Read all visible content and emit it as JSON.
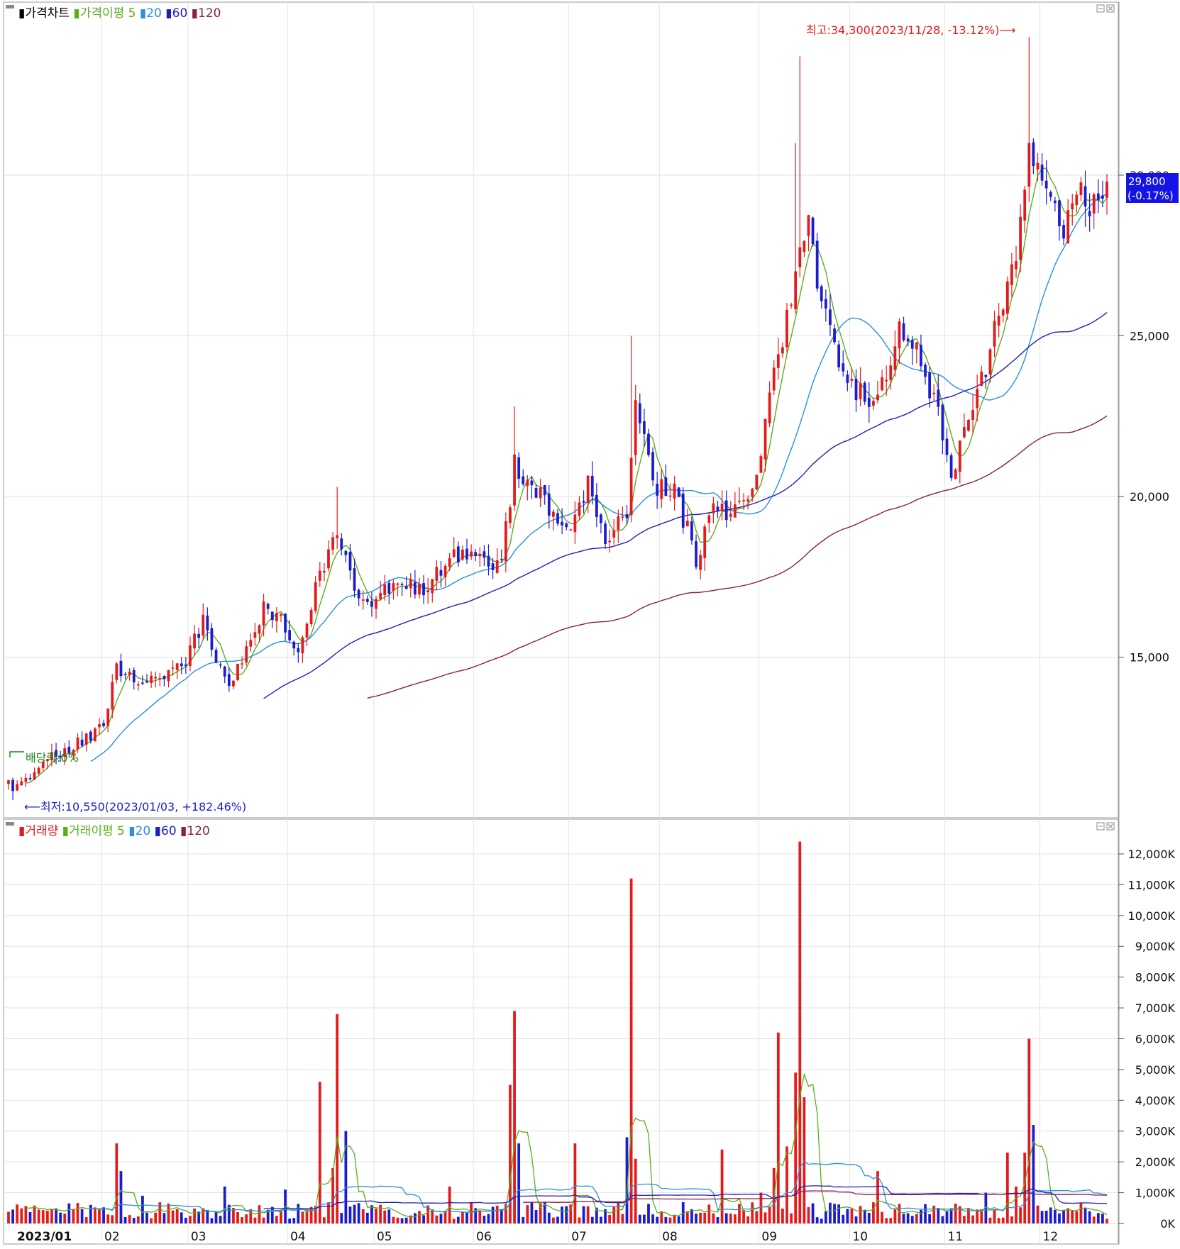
{
  "colors": {
    "up": "#e31b1b",
    "down": "#1c1ccf",
    "ma5": "#5aae1e",
    "ma20": "#2a8fe0",
    "ma60": "#1f1fbf",
    "ma120": "#8b1f4a",
    "grid": "#e2e2e2",
    "frame": "#9a9a9a",
    "current_bg": "#1414e6"
  },
  "price_panel": {
    "legend": [
      {
        "label": "가격차트",
        "color": "#000000"
      },
      {
        "label": "가격이평 5",
        "color": "#5aae1e"
      },
      {
        "label": "20",
        "color": "#2a8fe0"
      },
      {
        "label": "60",
        "color": "#1f1fbf"
      },
      {
        "label": "120",
        "color": "#8b1f4a"
      }
    ],
    "high_annotation": "최고:34,300(2023/11/28, -13.12%)⟶",
    "low_annotation": "⟵최저:10,550(2023/01/03, +182.46%)",
    "dividend_annotation": "배당락:0%",
    "current_price": "29,800",
    "current_change": "(-0.17%)"
  },
  "volume_panel": {
    "legend": [
      {
        "label": "거래량",
        "color": "#e31b1b"
      },
      {
        "label": "거래이평 5",
        "color": "#5aae1e"
      },
      {
        "label": "20",
        "color": "#2a8fe0"
      },
      {
        "label": "60",
        "color": "#1f1fbf"
      },
      {
        "label": "120",
        "color": "#8b1f4a"
      }
    ]
  },
  "chart_data": [
    {
      "type": "candlestick",
      "title": "",
      "ylim": [
        10000,
        35500
      ],
      "y_ticks": [
        {
          "value": 15000,
          "label": "15,000"
        },
        {
          "value": 20000,
          "label": "20,000"
        },
        {
          "value": 25000,
          "label": "25,000"
        },
        {
          "value": 30000,
          "label": "30,000"
        }
      ],
      "x_ticks": [
        "2023/01",
        "02",
        "03",
        "04",
        "05",
        "06",
        "07",
        "08",
        "09",
        "10",
        "11",
        "12"
      ],
      "price_keypoints": [
        [
          "2023/01/02",
          11200
        ],
        [
          "2023/01/03",
          10800
        ],
        [
          "2023/01/10",
          11500
        ],
        [
          "2023/01/20",
          12200
        ],
        [
          "2023/02/01",
          12800
        ],
        [
          "2023/02/06",
          14600
        ],
        [
          "2023/02/15",
          14300
        ],
        [
          "2023/02/28",
          14800
        ],
        [
          "2023/03/06",
          16200
        ],
        [
          "2023/03/14",
          13900
        ],
        [
          "2023/03/24",
          16500
        ],
        [
          "2023/03/31",
          16000
        ],
        [
          "2023/04/05",
          15200
        ],
        [
          "2023/04/12",
          17500
        ],
        [
          "2023/04/18",
          19000
        ],
        [
          "2023/04/25",
          16600
        ],
        [
          "2023/05/04",
          17200
        ],
        [
          "2023/05/16",
          17100
        ],
        [
          "2023/05/24",
          18200
        ],
        [
          "2023/06/01",
          18000
        ],
        [
          "2023/06/09",
          17900
        ],
        [
          "2023/06/14",
          21000
        ],
        [
          "2023/06/22",
          20000
        ],
        [
          "2023/06/30",
          19000
        ],
        [
          "2023/07/07",
          20300
        ],
        [
          "2023/07/13",
          18800
        ],
        [
          "2023/07/20",
          19500
        ],
        [
          "2023/07/24",
          23000
        ],
        [
          "2023/07/28",
          20400
        ],
        [
          "2023/08/04",
          20200
        ],
        [
          "2023/08/11",
          18100
        ],
        [
          "2023/08/17",
          19700
        ],
        [
          "2023/08/24",
          19500
        ],
        [
          "2023/08/31",
          20700
        ],
        [
          "2023/09/07",
          24600
        ],
        [
          "2023/09/12",
          25800
        ],
        [
          "2023/09/14",
          27600
        ],
        [
          "2023/09/18",
          29000
        ],
        [
          "2023/09/20",
          26800
        ],
        [
          "2023/09/27",
          24000
        ],
        [
          "2023/10/06",
          22800
        ],
        [
          "2023/10/13",
          23700
        ],
        [
          "2023/10/17",
          25200
        ],
        [
          "2023/10/24",
          24400
        ],
        [
          "2023/10/31",
          22000
        ],
        [
          "2023/11/02",
          20500
        ],
        [
          "2023/11/08",
          22300
        ],
        [
          "2023/11/13",
          23500
        ],
        [
          "2023/11/17",
          25600
        ],
        [
          "2023/11/23",
          27800
        ],
        [
          "2023/11/28",
          31200
        ],
        [
          "2023/12/04",
          29700
        ],
        [
          "2023/12/08",
          28200
        ],
        [
          "2023/12/13",
          29500
        ],
        [
          "2023/12/18",
          29200
        ],
        [
          "2023/12/22",
          29900
        ]
      ],
      "high": {
        "value": 34300,
        "date": "2023/11/28"
      },
      "low": {
        "value": 10550,
        "date": "2023/01/03"
      },
      "last": {
        "value": 29800,
        "change_pct": -0.17
      },
      "moving_averages": [
        5,
        20,
        60,
        120
      ]
    },
    {
      "type": "bar",
      "title": "",
      "ylabel": "",
      "ylim": [
        0,
        12500
      ],
      "unit": "K",
      "y_ticks": [
        {
          "value": 0,
          "label": "0K"
        },
        {
          "value": 1000,
          "label": "1,000K"
        },
        {
          "value": 2000,
          "label": "2,000K"
        },
        {
          "value": 3000,
          "label": "3,000K"
        },
        {
          "value": 4000,
          "label": "4,000K"
        },
        {
          "value": 5000,
          "label": "5,000K"
        },
        {
          "value": 6000,
          "label": "6,000K"
        },
        {
          "value": 7000,
          "label": "7,000K"
        },
        {
          "value": 8000,
          "label": "8,000K"
        },
        {
          "value": 9000,
          "label": "9,000K"
        },
        {
          "value": 10000,
          "label": "10,000K"
        },
        {
          "value": 11000,
          "label": "11,000K"
        },
        {
          "value": 12000,
          "label": "12,000K"
        }
      ],
      "volume_spikes_k": [
        [
          "2023/02/06",
          2600
        ],
        [
          "2023/02/07",
          1700
        ],
        [
          "2023/02/14",
          900
        ],
        [
          "2023/03/13",
          1200
        ],
        [
          "2023/03/31",
          1100
        ],
        [
          "2023/04/12",
          4600
        ],
        [
          "2023/04/17",
          1800
        ],
        [
          "2023/04/18",
          6800
        ],
        [
          "2023/04/20",
          3000
        ],
        [
          "2023/05/24",
          1200
        ],
        [
          "2023/06/13",
          4500
        ],
        [
          "2023/06/14",
          6900
        ],
        [
          "2023/06/15",
          2600
        ],
        [
          "2023/07/04",
          2600
        ],
        [
          "2023/07/20",
          2800
        ],
        [
          "2023/07/21",
          11200
        ],
        [
          "2023/07/24",
          2100
        ],
        [
          "2023/08/21",
          2400
        ],
        [
          "2023/09/01",
          1000
        ],
        [
          "2023/09/06",
          1800
        ],
        [
          "2023/09/07",
          6200
        ],
        [
          "2023/09/11",
          2500
        ],
        [
          "2023/09/13",
          4900
        ],
        [
          "2023/09/14",
          12400
        ],
        [
          "2023/09/15",
          4100
        ],
        [
          "2023/10/10",
          1700
        ],
        [
          "2023/11/14",
          1000
        ],
        [
          "2023/11/21",
          2300
        ],
        [
          "2023/11/23",
          1200
        ],
        [
          "2023/11/27",
          2300
        ],
        [
          "2023/11/28",
          6000
        ],
        [
          "2023/11/29",
          3200
        ]
      ],
      "base_volume_k": 420,
      "moving_averages": [
        5,
        20,
        60,
        120
      ]
    }
  ]
}
